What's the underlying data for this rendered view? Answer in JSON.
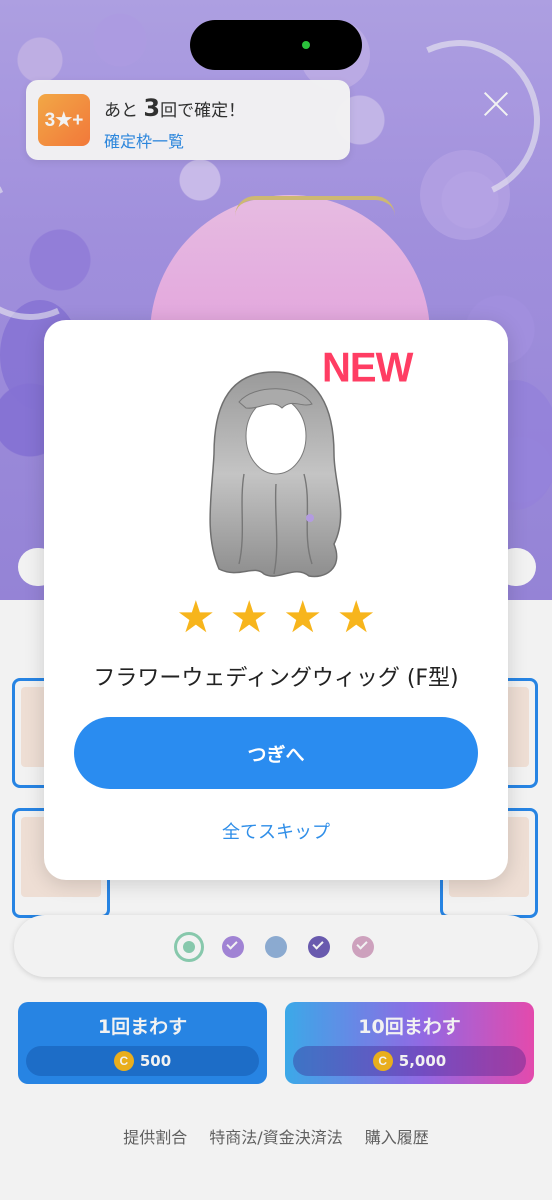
{
  "toast": {
    "badge": "3★+",
    "prefix": "あと",
    "count": "3",
    "suffix": "回で確定！",
    "link": "確定枠一覧"
  },
  "modal": {
    "new_label": "NEW",
    "rarity_stars": 4,
    "stars": [
      "★",
      "★",
      "★",
      "★"
    ],
    "item_name": "フラワーウェディングウィッグ (F型)",
    "next_button": "つぎへ",
    "skip_link": "全てスキップ"
  },
  "gacha": {
    "single": {
      "label": "1回まわす",
      "coin_icon": "C",
      "price": "500"
    },
    "ten": {
      "label": "10回まわす",
      "coin_icon": "C",
      "price": "5,000"
    }
  },
  "filter_dots": [
    {
      "name": "selected-radio",
      "color": "#8fd3b6"
    },
    {
      "name": "check-purple",
      "color": "#a98be0"
    },
    {
      "name": "plain-blue",
      "color": "#93b4dc"
    },
    {
      "name": "check-dark-purple",
      "color": "#6f5fb8"
    },
    {
      "name": "check-pink",
      "color": "#d9aac8"
    }
  ],
  "footer": {
    "rates": "提供割合",
    "legal": "特商法/資金決済法",
    "history": "購入履歴"
  },
  "colors": {
    "primary_blue": "#2a8cf0",
    "star_gold": "#f7b51c",
    "new_red": "#ff3d63",
    "toast_badge": "#ff9645"
  }
}
